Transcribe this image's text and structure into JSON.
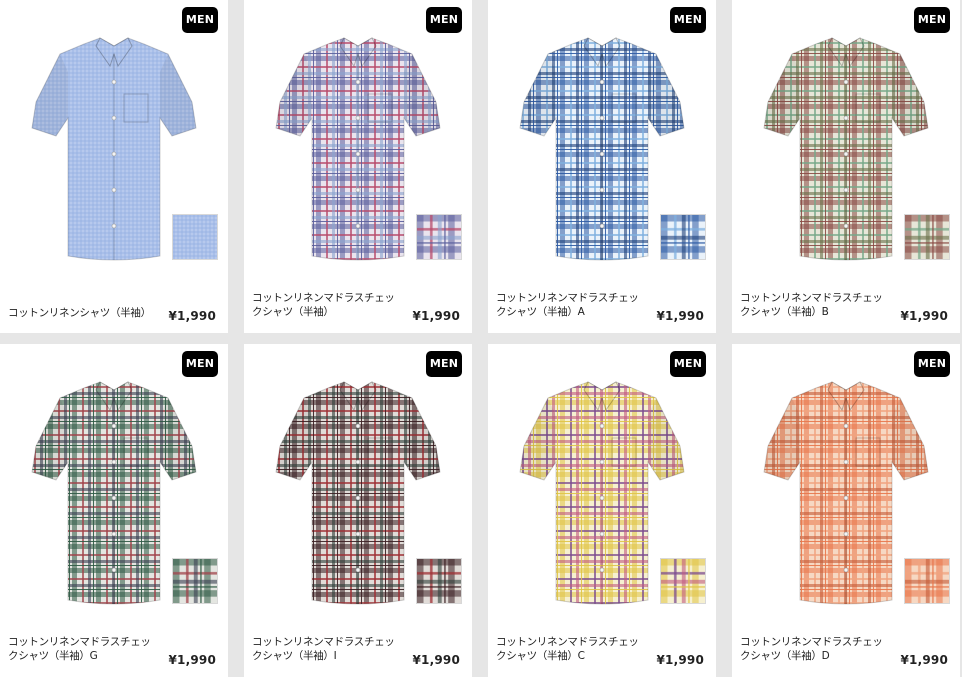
{
  "products": [
    {
      "badge": "MEN",
      "name": "コットンリネンシャツ（半袖）",
      "price": "¥1,990",
      "colors": {
        "base": "#a9bfe9",
        "c1": "#93aee0",
        "c2": "#c5d4f1",
        "c3": "#9db5e5"
      },
      "plain": true
    },
    {
      "badge": "MEN",
      "name": "コットンリネンマドラスチェックシャツ（半袖）",
      "price": "¥1,990",
      "colors": {
        "base": "#e9e4ee",
        "c1": "#5b5f9e",
        "c2": "#b84a6a",
        "c3": "#8aa3cf"
      },
      "plain": false
    },
    {
      "badge": "MEN",
      "name": "コットンリネンマドラスチェックシャツ（半袖）A",
      "price": "¥1,990",
      "colors": {
        "base": "#eaf2fa",
        "c1": "#2d5aa3",
        "c2": "#7fb0de",
        "c3": "#1e3f7a"
      },
      "plain": false
    },
    {
      "badge": "MEN",
      "name": "コットンリネンマドラスチェックシャツ（半袖）B",
      "price": "¥1,990",
      "colors": {
        "base": "#e7e6d8",
        "c1": "#8b4a45",
        "c2": "#77a889",
        "c3": "#6a6f4a"
      },
      "plain": false
    },
    {
      "badge": "MEN",
      "name": "コットンリネンマドラスチェックシャツ（半袖）G",
      "price": "¥1,990",
      "colors": {
        "base": "#e4e6e1",
        "c1": "#2f5a45",
        "c2": "#a1424a",
        "c3": "#3b3f52"
      },
      "plain": false
    },
    {
      "badge": "MEN",
      "name": "コットンリネンマドラスチェックシャツ（半袖）I",
      "price": "¥1,990",
      "colors": {
        "base": "#e1dcd8",
        "c1": "#3b1f23",
        "c2": "#9e2f34",
        "c3": "#2f3f3a"
      },
      "plain": false
    },
    {
      "badge": "MEN",
      "name": "コットンリネンマドラスチェックシャツ（半袖）C",
      "price": "¥1,990",
      "colors": {
        "base": "#f6f0cf",
        "c1": "#e0c545",
        "c2": "#7a4a8e",
        "c3": "#c25a80"
      },
      "plain": false
    },
    {
      "badge": "MEN",
      "name": "コットンリネンマドラスチェックシャツ（半袖）D",
      "price": "¥1,990",
      "colors": {
        "base": "#f6d8c3",
        "c1": "#e8774b",
        "c2": "#f0a27e",
        "c3": "#c45a35"
      },
      "plain": false
    }
  ]
}
